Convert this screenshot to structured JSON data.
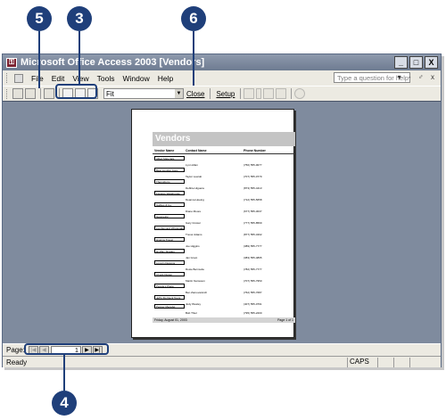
{
  "callouts": [
    "5",
    "3",
    "6",
    "4"
  ],
  "window": {
    "title": "Microsoft Office Access 2003 [Vendors]",
    "minimize_glyph": "_",
    "restore_glyph": "□",
    "close_glyph": "X"
  },
  "menu": {
    "items": [
      "File",
      "Edit",
      "View",
      "Tools",
      "Window",
      "Help"
    ],
    "help_placeholder": "Type a question for help",
    "right_controls": "▾ - ♂ x"
  },
  "toolbar": {
    "zoom_value": "Fit",
    "close_label": "Close",
    "setup_label": "Setup"
  },
  "report": {
    "title": "Vendors",
    "headers": [
      "Vendor Name",
      "Contact Name",
      "Phone Number"
    ],
    "rows": [
      {
        "company": "Allied Materials",
        "contact": "Lynn Allan",
        "phone": "(750) 555-0077"
      },
      {
        "company": "Best Lumber Corp.",
        "contact": "Taylor Lowski",
        "phone": "(707) 555-0779"
      },
      {
        "company": "Thermiform",
        "contact": "Debbie Higuera",
        "phone": "(873) 555-4413"
      },
      {
        "company": "Fixtures Warehouse",
        "contact": "Deanna Hoeing",
        "phone": "(712) 555-5658"
      },
      {
        "company": "Gables & Co.",
        "contact": "Diane Moore",
        "phone": "(677) 555-3037"
      },
      {
        "company": "Geometric",
        "contact": "Gary Crosier",
        "phone": "(777) 555-8569"
      },
      {
        "company": "Lumberyard Wholesale",
        "contact": "Trevor Adams",
        "phone": "(877) 555-3402"
      },
      {
        "company": "Higgins Travel",
        "contact": "Joe Higgins",
        "phone": "(389) 555-7777"
      },
      {
        "company": "Hi-Way Shades",
        "contact": "Jan Groot",
        "phone": "(383) 555-4895"
      },
      {
        "company": "Lincoln Designs",
        "contact": "Rosie Bermuda",
        "phone": "(782) 555-7777"
      },
      {
        "company": "Chuck Duster",
        "contact": "Martin Samuson",
        "phone": "(707) 555-7950"
      },
      {
        "company": "People's Place",
        "contact": "Ben Zamovaninch",
        "phone": "(762) 555-7687"
      },
      {
        "company": "Jeff's Do Deck Tours",
        "contact": "Judy Wesley",
        "phone": "(407) 555-0791"
      },
      {
        "company": "Pepper Meredel",
        "contact": "Bob Thiel",
        "phone": "(795) 555-2200"
      }
    ],
    "footer_left": "Friday, August 01, 2003",
    "footer_right": "Page 1 of 1"
  },
  "nav": {
    "label": "Page:",
    "page_number": "1",
    "first_glyph": "|◀",
    "prev_glyph": "◀",
    "next_glyph": "▶",
    "last_glyph": "▶|"
  },
  "status": {
    "text": "Ready",
    "caps": "CAPS"
  }
}
